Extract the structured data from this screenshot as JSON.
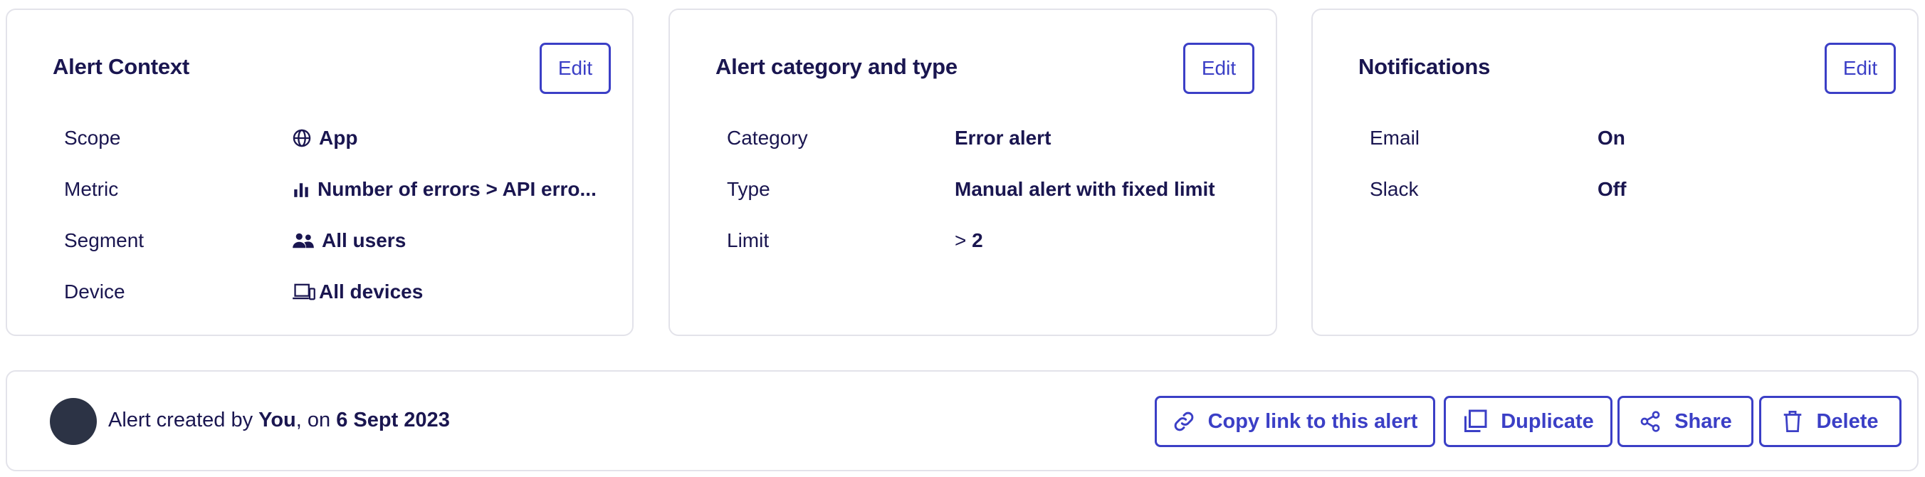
{
  "alert_context": {
    "title": "Alert Context",
    "edit_label": "Edit",
    "rows": [
      {
        "label": "Scope",
        "value": "App",
        "icon": "globe-icon"
      },
      {
        "label": "Metric",
        "value": "Number of errors > API erro...",
        "icon": "bar-chart-icon"
      },
      {
        "label": "Segment",
        "value": "All users",
        "icon": "users-icon"
      },
      {
        "label": "Device",
        "value": "All devices",
        "icon": "devices-icon"
      }
    ]
  },
  "alert_category": {
    "title": "Alert category and type",
    "edit_label": "Edit",
    "rows": [
      {
        "label": "Category",
        "value": "Error alert"
      },
      {
        "label": "Type",
        "value": "Manual alert with fixed limit"
      },
      {
        "label": "Limit",
        "value_prefix": "> ",
        "value": "2"
      }
    ]
  },
  "notifications": {
    "title": "Notifications",
    "edit_label": "Edit",
    "rows": [
      {
        "label": "Email",
        "value": "On"
      },
      {
        "label": "Slack",
        "value": "Off"
      }
    ]
  },
  "footer": {
    "created_prefix": "Alert created by ",
    "created_by": "You",
    "created_mid": ", on ",
    "created_date": "6 Sept 2023",
    "actions": {
      "copy_link": "Copy link to this alert",
      "duplicate": "Duplicate",
      "share": "Share",
      "delete": "Delete"
    }
  },
  "colors": {
    "accent": "#3b3fc6",
    "text": "#1a1650",
    "border": "#e3e3ea",
    "avatar": "#2c3345"
  }
}
